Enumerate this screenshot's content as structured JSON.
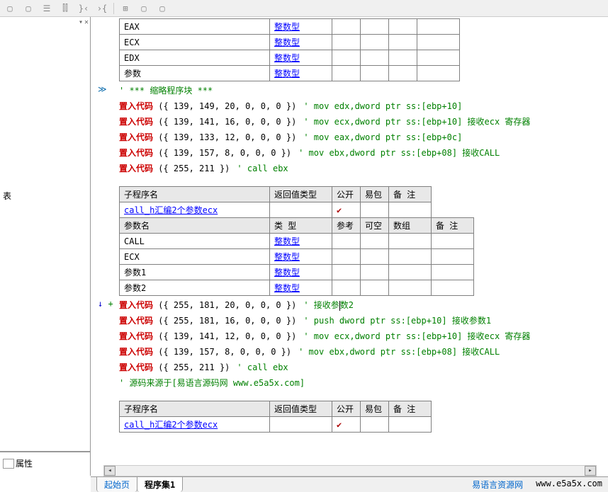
{
  "toolbar_icons": [
    "□",
    "□",
    "□",
    "≡",
    "叩",
    "}<",
    ">{",
    "",
    "⊞",
    "□",
    "□"
  ],
  "left": {
    "char": "表",
    "prop": "属性"
  },
  "table1": {
    "rows": [
      {
        "name": "EAX",
        "type": "整数型"
      },
      {
        "name": "ECX",
        "type": "整数型"
      },
      {
        "name": "EDX",
        "type": "整数型"
      },
      {
        "name": "参数",
        "type": "整数型"
      }
    ]
  },
  "block1": {
    "title": "' *** 缩略程序块 ***",
    "lines": [
      {
        "fn": "置入代码",
        "args": "({ 139, 149, 20, 0, 0, 0 })",
        "cm": "' mov edx,dword ptr ss:[ebp+10]"
      },
      {
        "fn": "置入代码",
        "args": "({ 139, 141, 16, 0, 0, 0 })",
        "cm": "' mov ecx,dword ptr ss:[ebp+10] 接收ecx 寄存器"
      },
      {
        "fn": "置入代码",
        "args": "({ 139, 133, 12, 0, 0, 0 })",
        "cm": "' mov eax,dword ptr ss:[ebp+0c]"
      },
      {
        "fn": "置入代码",
        "args": "({ 139, 157, 8, 0, 0, 0 })",
        "cm": "' mov ebx,dword ptr ss:[ebp+08] 接收CALL"
      },
      {
        "fn": "置入代码",
        "args": "({ 255, 211 })",
        "cm": "' call ebx"
      }
    ]
  },
  "table2": {
    "h1": [
      "子程序名",
      "返回值类型",
      "公开",
      "易包",
      "备 注"
    ],
    "name": "call_h汇编2个参数ecx",
    "h2": [
      "参数名",
      "类 型",
      "参考",
      "可空",
      "数组",
      "备 注"
    ],
    "rows": [
      {
        "name": "CALL",
        "type": "整数型"
      },
      {
        "name": "ECX",
        "type": "整数型"
      },
      {
        "name": "参数1",
        "type": "整数型"
      },
      {
        "name": "参数2",
        "type": "整数型"
      }
    ]
  },
  "block2": {
    "lines": [
      {
        "fn": "置入代码",
        "args": "({ 255, 181, 20, 0, 0, 0 })",
        "cm": "' 接收参数2",
        "cursor": true
      },
      {
        "fn": "置入代码",
        "args": "({ 255, 181, 16, 0, 0, 0 })",
        "cm": "' push dword ptr ss:[ebp+10] 接收参数1"
      },
      {
        "fn": "置入代码",
        "args": "({ 139, 141, 12, 0, 0, 0 })",
        "cm": "' mov ecx,dword ptr ss:[ebp+10] 接收ecx 寄存器"
      },
      {
        "fn": "置入代码",
        "args": "({ 139, 157, 8, 0, 0, 0 })",
        "cm": "' mov ebx,dword ptr ss:[ebp+08] 接收CALL"
      },
      {
        "fn": "置入代码",
        "args": "({ 255, 211 })",
        "cm": "' call ebx"
      }
    ],
    "src": "' 源码来源于[易语言源码网 www.e5a5x.com]"
  },
  "table3": {
    "h1": [
      "子程序名",
      "返回值类型",
      "公开",
      "易包",
      "备 注"
    ],
    "name": "call_h汇编2个参数ecx"
  },
  "tabs": {
    "start": "起始页",
    "active": "程序集1"
  },
  "footer": {
    "cn": "易语言资源网",
    "url": "www.e5a5x.com"
  }
}
